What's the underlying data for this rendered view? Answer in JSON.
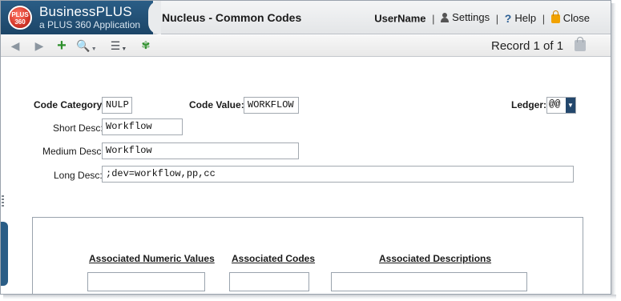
{
  "window": {
    "brand_name": "BusinessPLUS",
    "brand_sub": "a PLUS 360 Application",
    "logo_text_1": "PLUS",
    "logo_text_2": "360",
    "app_title": "Nucleus - Common Codes"
  },
  "topnav": {
    "username": "UserName",
    "settings_label": "Settings",
    "help_label": "Help",
    "close_label": "Close"
  },
  "toolbar": {
    "icons": [
      "prev-record-icon",
      "next-record-icon",
      "add-icon",
      "search-icon",
      "list-icon",
      "link-icon"
    ],
    "record_status": "Record 1 of 1"
  },
  "form": {
    "code_category_label": "Code Category:",
    "code_category_value": "NULP",
    "code_value_label": "Code Value:",
    "code_value_value": "WORKFLOW",
    "ledger_label": "Ledger:",
    "ledger_value": "@@",
    "short_desc_label": "Short Desc:",
    "short_desc_value": "Workflow",
    "medium_desc_label": "Medium Desc:",
    "medium_desc_value": "Workflow",
    "long_desc_label": "Long Desc:",
    "long_desc_value": ";dev=workflow,pp,cc"
  },
  "associated": {
    "numeric_values_header": "Associated Numeric Values",
    "codes_header": "Associated Codes",
    "descriptions_header": "Associated Descriptions"
  },
  "colors": {
    "brand_blue": "#2a5d86",
    "add_green": "#2d8f2b",
    "lock_orange": "#f1a200",
    "help_blue": "#2b5e93"
  }
}
